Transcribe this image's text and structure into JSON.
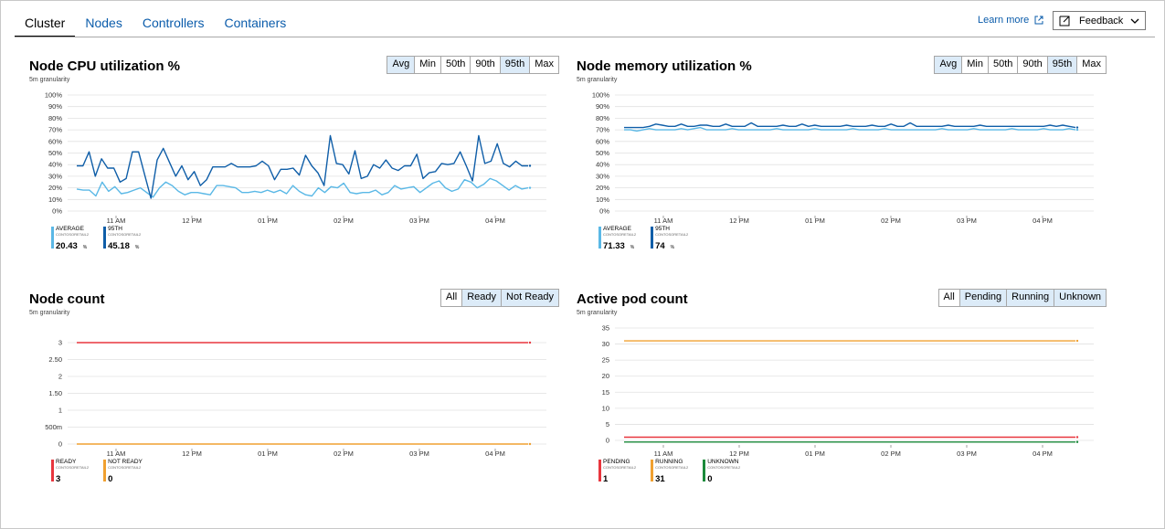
{
  "tabs": [
    {
      "label": "Cluster",
      "active": true
    },
    {
      "label": "Nodes",
      "active": false
    },
    {
      "label": "Controllers",
      "active": false
    },
    {
      "label": "Containers",
      "active": false
    }
  ],
  "header": {
    "learn_more": "Learn more",
    "feedback": "Feedback"
  },
  "colors": {
    "light_blue": "#5ab8e6",
    "dark_blue": "#0f5ea8",
    "red": "#e8363e",
    "orange": "#f0a030",
    "green": "#1a8a3a",
    "grid": "#e1e1e1",
    "selected_button": "#dcebf8"
  },
  "x_ticks": [
    "11 AM",
    "12 PM",
    "01 PM",
    "02 PM",
    "03 PM",
    "04 PM"
  ],
  "panels": {
    "cpu": {
      "title": "Node CPU utilization %",
      "granularity": "5m granularity",
      "buttons": [
        {
          "label": "Avg",
          "selected": true
        },
        {
          "label": "Min",
          "selected": false
        },
        {
          "label": "50th",
          "selected": false
        },
        {
          "label": "90th",
          "selected": false
        },
        {
          "label": "95th",
          "selected": true
        },
        {
          "label": "Max",
          "selected": false
        }
      ],
      "legend": [
        {
          "name": "AVERAGE",
          "sub": "CONTOSORETAIL2",
          "value": "20.43",
          "unit": "%",
          "color": "#5ab8e6"
        },
        {
          "name": "95TH",
          "sub": "CONTOSORETAIL2",
          "value": "45.18",
          "unit": "%",
          "color": "#0f5ea8"
        }
      ]
    },
    "memory": {
      "title": "Node memory utilization %",
      "granularity": "5m granularity",
      "buttons": [
        {
          "label": "Avg",
          "selected": true
        },
        {
          "label": "Min",
          "selected": false
        },
        {
          "label": "50th",
          "selected": false
        },
        {
          "label": "90th",
          "selected": false
        },
        {
          "label": "95th",
          "selected": true
        },
        {
          "label": "Max",
          "selected": false
        }
      ],
      "legend": [
        {
          "name": "AVERAGE",
          "sub": "CONTOSORETAIL2",
          "value": "71.33",
          "unit": "%",
          "color": "#5ab8e6"
        },
        {
          "name": "95TH",
          "sub": "CONTOSORETAIL2",
          "value": "74",
          "unit": "%",
          "color": "#0f5ea8"
        }
      ]
    },
    "nodes": {
      "title": "Node count",
      "granularity": "5m granularity",
      "buttons": [
        {
          "label": "All",
          "selected": false
        },
        {
          "label": "Ready",
          "selected": true
        },
        {
          "label": "Not Ready",
          "selected": true
        }
      ],
      "legend": [
        {
          "name": "READY",
          "sub": "CONTOSORETAIL2",
          "value": "3",
          "unit": "",
          "color": "#e8363e"
        },
        {
          "name": "NOT READY",
          "sub": "CONTOSORETAIL2",
          "value": "0",
          "unit": "",
          "color": "#f0a030"
        }
      ]
    },
    "pods": {
      "title": "Active pod count",
      "granularity": "5m granularity",
      "buttons": [
        {
          "label": "All",
          "selected": false
        },
        {
          "label": "Pending",
          "selected": true
        },
        {
          "label": "Running",
          "selected": true
        },
        {
          "label": "Unknown",
          "selected": true
        }
      ],
      "legend": [
        {
          "name": "PENDING",
          "sub": "CONTOSORETAIL2",
          "value": "1",
          "unit": "",
          "color": "#e8363e"
        },
        {
          "name": "RUNNING",
          "sub": "CONTOSORETAIL2",
          "value": "31",
          "unit": "",
          "color": "#f0a030"
        },
        {
          "name": "UNKNOWN",
          "sub": "CONTOSORETAIL2",
          "value": "0",
          "unit": "",
          "color": "#1a8a3a"
        }
      ]
    }
  },
  "chart_data": [
    {
      "type": "line",
      "y_ticks": [
        "0%",
        "10%",
        "20%",
        "30%",
        "40%",
        "50%",
        "60%",
        "70%",
        "80%",
        "90%",
        "100%"
      ],
      "ylim": [
        0,
        100
      ],
      "grid": true,
      "series": [
        {
          "name": "AVERAGE",
          "color": "#5ab8e6",
          "values": [
            19,
            18,
            18,
            13,
            25,
            17,
            21,
            15,
            16,
            18,
            20,
            16,
            12,
            20,
            25,
            22,
            17,
            14,
            16,
            16,
            15,
            14,
            22,
            22,
            21,
            20,
            16,
            16,
            17,
            16,
            18,
            16,
            18,
            15,
            22,
            17,
            14,
            13,
            20,
            16,
            21,
            20,
            24,
            16,
            15,
            16,
            16,
            18,
            14,
            16,
            22,
            19,
            20,
            21,
            16,
            20,
            24,
            26,
            20,
            17,
            19,
            27,
            25,
            20,
            23,
            28,
            26,
            22,
            18,
            22,
            19,
            20
          ]
        },
        {
          "name": "95TH",
          "color": "#0f5ea8",
          "values": [
            39,
            39,
            51,
            30,
            45,
            37,
            37,
            25,
            28,
            51,
            51,
            31,
            11,
            44,
            54,
            42,
            30,
            39,
            27,
            34,
            22,
            27,
            38,
            38,
            38,
            41,
            38,
            38,
            38,
            39,
            43,
            39,
            27,
            36,
            36,
            37,
            31,
            48,
            39,
            33,
            22,
            65,
            41,
            40,
            32,
            52,
            28,
            30,
            40,
            37,
            44,
            37,
            35,
            39,
            39,
            49,
            28,
            33,
            34,
            41,
            40,
            41,
            51,
            39,
            26,
            65,
            41,
            43,
            58,
            41,
            38,
            43,
            39,
            39
          ]
        }
      ]
    },
    {
      "type": "line",
      "y_ticks": [
        "0%",
        "10%",
        "20%",
        "30%",
        "40%",
        "50%",
        "60%",
        "70%",
        "80%",
        "90%",
        "100%"
      ],
      "ylim": [
        0,
        100
      ],
      "grid": true,
      "series": [
        {
          "name": "AVERAGE",
          "color": "#5ab8e6",
          "values": [
            70,
            70,
            69,
            70,
            71,
            70,
            70,
            70,
            70,
            71,
            70,
            71,
            72,
            70,
            70,
            70,
            70,
            71,
            70,
            70,
            70,
            70,
            70,
            70,
            71,
            70,
            70,
            70,
            70,
            70,
            71,
            70,
            70,
            70,
            70,
            70,
            71,
            70,
            70,
            70,
            70,
            71,
            70,
            70,
            70,
            70,
            70,
            70,
            70,
            70,
            71,
            70,
            70,
            70,
            70,
            71,
            70,
            70,
            70,
            70,
            70,
            71,
            70,
            70,
            70,
            70,
            71,
            70,
            70,
            70,
            71,
            70
          ]
        },
        {
          "name": "95TH",
          "color": "#0f5ea8",
          "values": [
            72,
            72,
            72,
            72,
            73,
            75,
            74,
            73,
            73,
            75,
            73,
            73,
            74,
            74,
            73,
            73,
            75,
            73,
            73,
            73,
            76,
            73,
            73,
            73,
            73,
            74,
            73,
            73,
            75,
            73,
            74,
            73,
            73,
            73,
            73,
            74,
            73,
            73,
            73,
            74,
            73,
            73,
            75,
            73,
            73,
            76,
            73,
            73,
            73,
            73,
            73,
            74,
            73,
            73,
            73,
            73,
            74,
            73,
            73,
            73,
            73,
            73,
            73,
            73,
            73,
            73,
            73,
            74,
            73,
            74,
            73,
            72
          ]
        }
      ]
    },
    {
      "type": "line",
      "y_ticks": [
        "0",
        "500m",
        "1",
        "1.50",
        "2",
        "2.50",
        "3"
      ],
      "ylim": [
        0,
        3.25
      ],
      "grid": true,
      "series": [
        {
          "name": "READY",
          "color": "#e8363e",
          "values": [
            3,
            3
          ]
        },
        {
          "name": "NOT READY",
          "color": "#f0a030",
          "values": [
            0,
            0
          ]
        }
      ]
    },
    {
      "type": "line",
      "y_ticks": [
        "0",
        "5",
        "10",
        "15",
        "20",
        "25",
        "30",
        "35"
      ],
      "ylim": [
        -1,
        35
      ],
      "grid": true,
      "series": [
        {
          "name": "PENDING",
          "color": "#e8363e",
          "values": [
            1,
            1
          ]
        },
        {
          "name": "RUNNING",
          "color": "#f0a030",
          "values": [
            31,
            31
          ]
        },
        {
          "name": "UNKNOWN",
          "color": "#1a8a3a",
          "values": [
            -0.5,
            -0.5
          ]
        }
      ]
    }
  ]
}
